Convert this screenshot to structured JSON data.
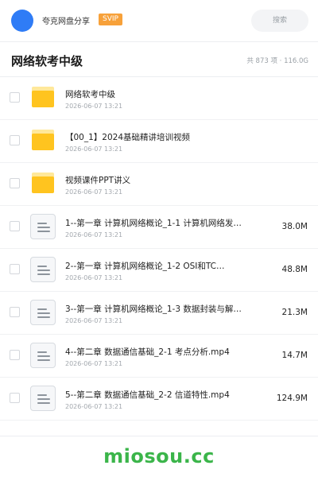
{
  "header": {
    "app_title": "夸克网盘分享",
    "badge": "SVIP",
    "search_placeholder": "搜索"
  },
  "folder": {
    "title": "网络软考中级",
    "stats": "共 873 项 · 116.0G"
  },
  "items": [
    {
      "type": "folder",
      "name": "网络软考中级",
      "date": "2026-06-07 13:21",
      "size": ""
    },
    {
      "type": "folder",
      "name": "【00_1】2024基础精讲培训视频",
      "date": "2026-06-07 13:21",
      "size": ""
    },
    {
      "type": "folder",
      "name": "视频课件PPT讲义",
      "date": "2026-06-07 13:21",
      "size": ""
    },
    {
      "type": "file",
      "name": "1--第一章 计算机网络概论_1-1 计算机网络发…",
      "date": "2026-06-07 13:21",
      "size": "38.0M"
    },
    {
      "type": "file",
      "name": "2--第一章 计算机网络概论_1-2 OSI和TC…",
      "date": "2026-06-07 13:21",
      "size": "48.8M"
    },
    {
      "type": "file",
      "name": "3--第一章 计算机网络概论_1-3 数据封装与解…",
      "date": "2026-06-07 13:21",
      "size": "21.3M"
    },
    {
      "type": "file",
      "name": "4--第二章 数据通信基础_2-1 考点分析.mp4",
      "date": "2026-06-07 13:21",
      "size": "14.7M"
    },
    {
      "type": "file",
      "name": "5--第二章 数据通信基础_2-2 信道特性.mp4",
      "date": "2026-06-07 13:21",
      "size": "124.9M"
    }
  ],
  "watermark": "miosou.cc",
  "colors": {
    "accent": "#2f7cf6",
    "badge": "#f7a13a",
    "folder": "#ffc41f",
    "watermark": "#3bb54a"
  },
  "icons": {
    "folder": "folder-icon",
    "file": "video-file-icon"
  }
}
